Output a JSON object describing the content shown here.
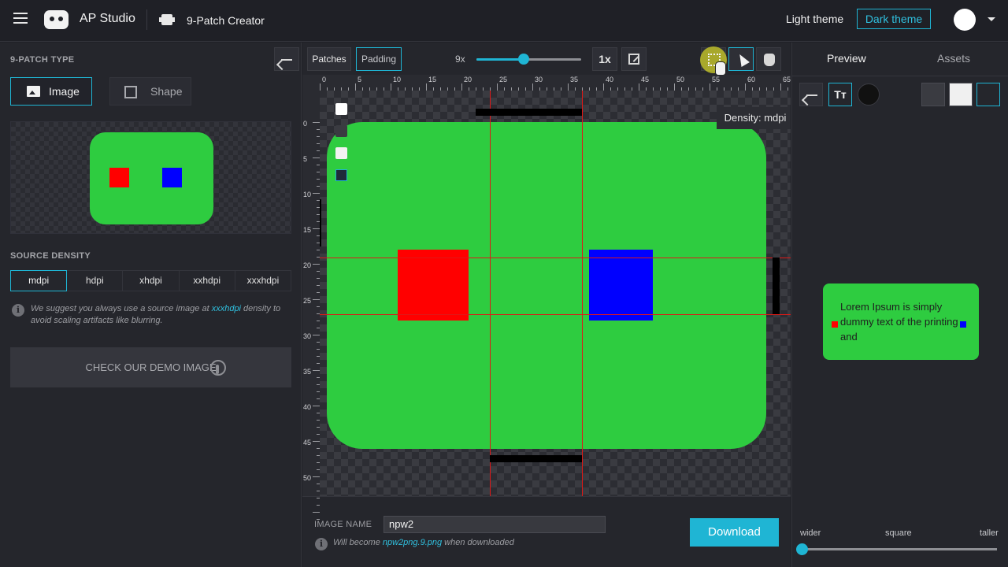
{
  "app": {
    "brand": "AP Studio",
    "page_name": "9-Patch Creator"
  },
  "theme": {
    "light_label": "Light theme",
    "dark_label": "Dark theme",
    "active": "Dark theme"
  },
  "left": {
    "type_label": "9-PATCH TYPE",
    "type_options": {
      "image": "Image",
      "shape": "Shape"
    },
    "selected_type": "Image",
    "density_label": "SOURCE DENSITY",
    "densities": [
      "mdpi",
      "hdpi",
      "xhdpi",
      "xxhdpi",
      "xxxhdpi"
    ],
    "selected_density": "mdpi",
    "suggest_pre": "We suggest you always use a source image at ",
    "suggest_link": "xxxhdpi",
    "suggest_post": " density to avoid scaling artifacts like blurring.",
    "demo_label": "CHECK OUR DEMO IMAGE"
  },
  "toolbar": {
    "patches_label": "Patches",
    "padding_label": "Padding",
    "zoom_label": "9x",
    "zoom_level": 0.45,
    "one_x_label": "1x"
  },
  "rulers": {
    "x_ticks": [
      "0",
      "5",
      "10",
      "15",
      "20",
      "25",
      "30",
      "35",
      "40",
      "45",
      "50",
      "55",
      "60",
      "65"
    ],
    "y_ticks": [
      "0",
      "5",
      "10",
      "15",
      "20",
      "25",
      "30",
      "35",
      "40",
      "45",
      "50"
    ]
  },
  "canvas": {
    "density_badge": "Density: mdpi"
  },
  "footer": {
    "image_name_label": "IMAGE NAME",
    "image_name_value": "npw2",
    "become_pre": "Will become ",
    "become_file": "npw2png.9.png",
    "become_post": " when downloaded",
    "download_label": "Download"
  },
  "right": {
    "tabs": [
      "Preview",
      "Assets"
    ],
    "active_tab": "Preview",
    "text_toggle": "Tт",
    "preview_text": "Lorem Ipsum is simply dummy text of the printing and",
    "aspect": {
      "wider": "wider",
      "square": "square",
      "taller": "taller",
      "value": 0.0
    }
  },
  "colors": {
    "accent": "#1fb5d4",
    "patch_green": "#2ecc40",
    "marker_red": "#ff0000",
    "marker_blue": "#0000ff",
    "guide_red": "#e01818"
  },
  "icons": {
    "menu": "menu-icon",
    "logo": "logo-icon",
    "tool": "nine-patch-tool-icon",
    "back": "arrow-left-icon",
    "select": "rectangle-select-icon",
    "pointer": "pointer-icon",
    "hand": "hand-icon",
    "expand": "expand-icon",
    "info": "info-icon",
    "touch": "touch-icon"
  }
}
